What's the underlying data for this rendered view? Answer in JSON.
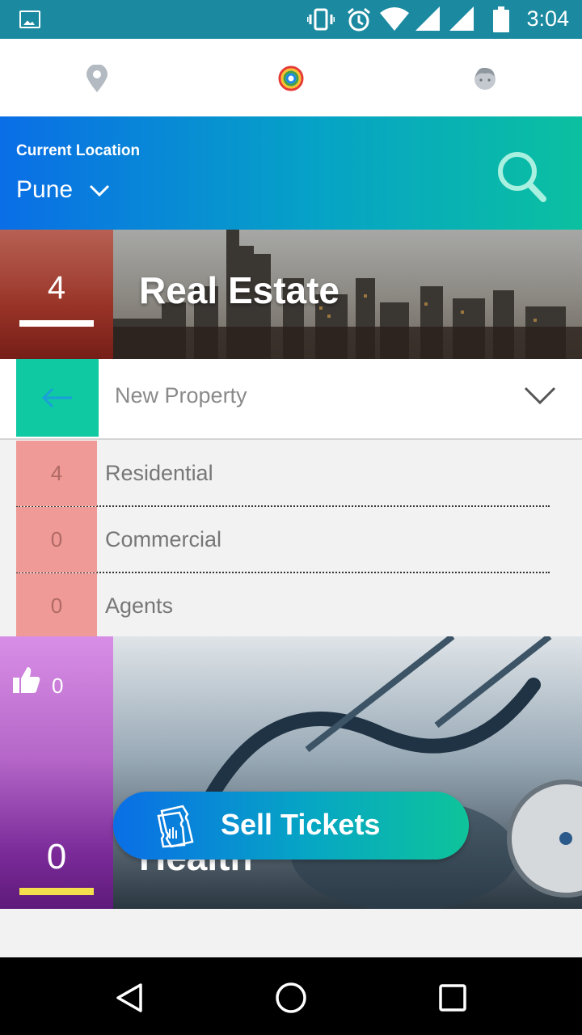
{
  "status_bar": {
    "time": "3:04",
    "icons": [
      "image-icon",
      "vibrate-icon",
      "alarm-icon",
      "wifi-icon",
      "signal-icon",
      "signal-icon",
      "battery-icon"
    ]
  },
  "top_nav": {
    "tabs": [
      {
        "name": "location-pin-icon"
      },
      {
        "name": "rainbow-ring-icon"
      },
      {
        "name": "profile-face-icon"
      }
    ]
  },
  "location": {
    "label": "Current Location",
    "city": "Pune",
    "search_icon": "search-icon"
  },
  "real_estate": {
    "count": "4",
    "title": "Real Estate",
    "dropdown": {
      "selected": "New Property",
      "back_icon": "arrow-left-icon"
    },
    "items": [
      {
        "count": "4",
        "label": "Residential"
      },
      {
        "count": "0",
        "label": "Commercial"
      },
      {
        "count": "0",
        "label": "Agents"
      }
    ]
  },
  "health": {
    "likes": "0",
    "count": "0",
    "title": "Health"
  },
  "sell_tickets": {
    "label": "Sell Tickets",
    "icon": "ticket-icon"
  },
  "colors": {
    "status_bar": "#1b8aa0",
    "accent_teal": "#0fc9a2",
    "gradient_blue": "#0a6ee6",
    "list_num_bg": "#ef9a96",
    "health_underline": "#f4e04c"
  }
}
